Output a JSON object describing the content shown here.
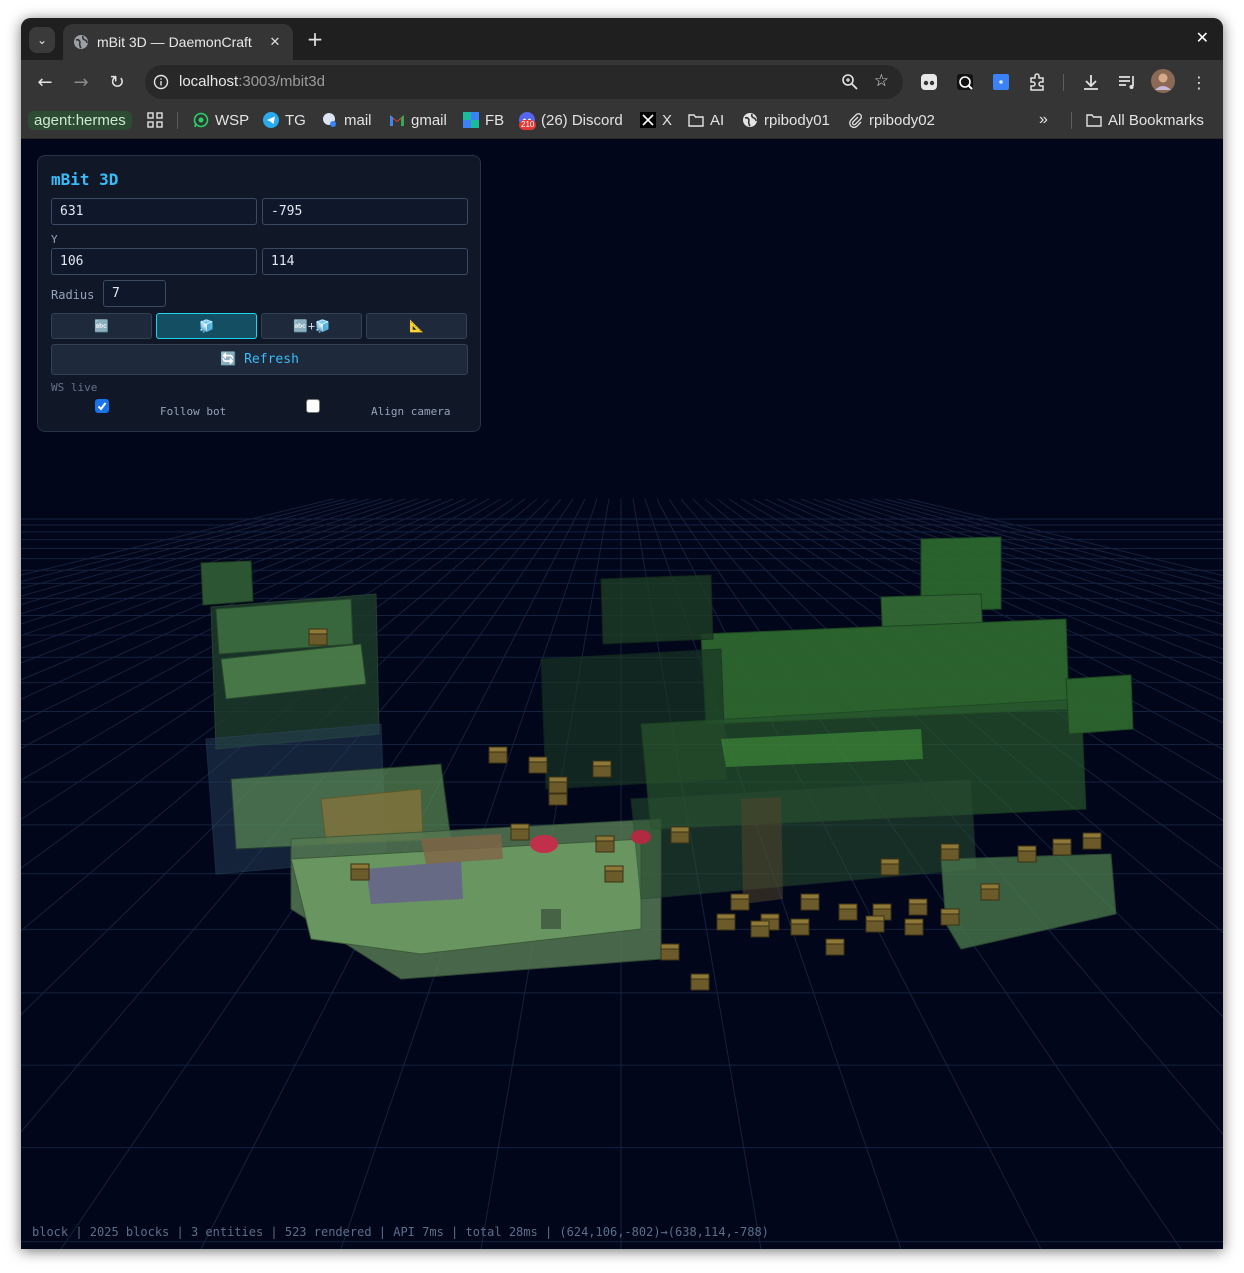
{
  "browser": {
    "tab_title": "mBit 3D — DaemonCraft",
    "url_host": "localhost",
    "url_path": ":3003/mbit3d",
    "bookmarks": {
      "agent_chip": "agent:hermes",
      "items": [
        "WSP",
        "TG",
        "mail",
        "gmail",
        "FB",
        "(26) Discord",
        "X",
        "AI",
        "rpibody01",
        "rpibody02"
      ],
      "discord_badge": "210",
      "all_bookmarks": "All Bookmarks"
    }
  },
  "panel": {
    "title": "mBit 3D",
    "x_value": "631",
    "z_value": "-795",
    "y_label": "Y",
    "y_min": "106",
    "y_max": "114",
    "radius_label": "Radius",
    "radius_value": "7",
    "mode_buttons": [
      {
        "label": "🔤",
        "active": false
      },
      {
        "label": "🧊",
        "active": true
      },
      {
        "label": "🔤+🧊",
        "active": false
      },
      {
        "label": "📐",
        "active": false
      }
    ],
    "refresh_label": "🔄 Refresh",
    "ws_label": "WS live",
    "follow_bot_label": "Follow bot",
    "follow_bot_checked": true,
    "align_camera_label": "Align camera",
    "align_camera_checked": false
  },
  "status_bar": "block | 2025 blocks | 3 entities | 523 rendered | API 7ms | total 28ms | (624,106,-802)→(638,114,-788)"
}
